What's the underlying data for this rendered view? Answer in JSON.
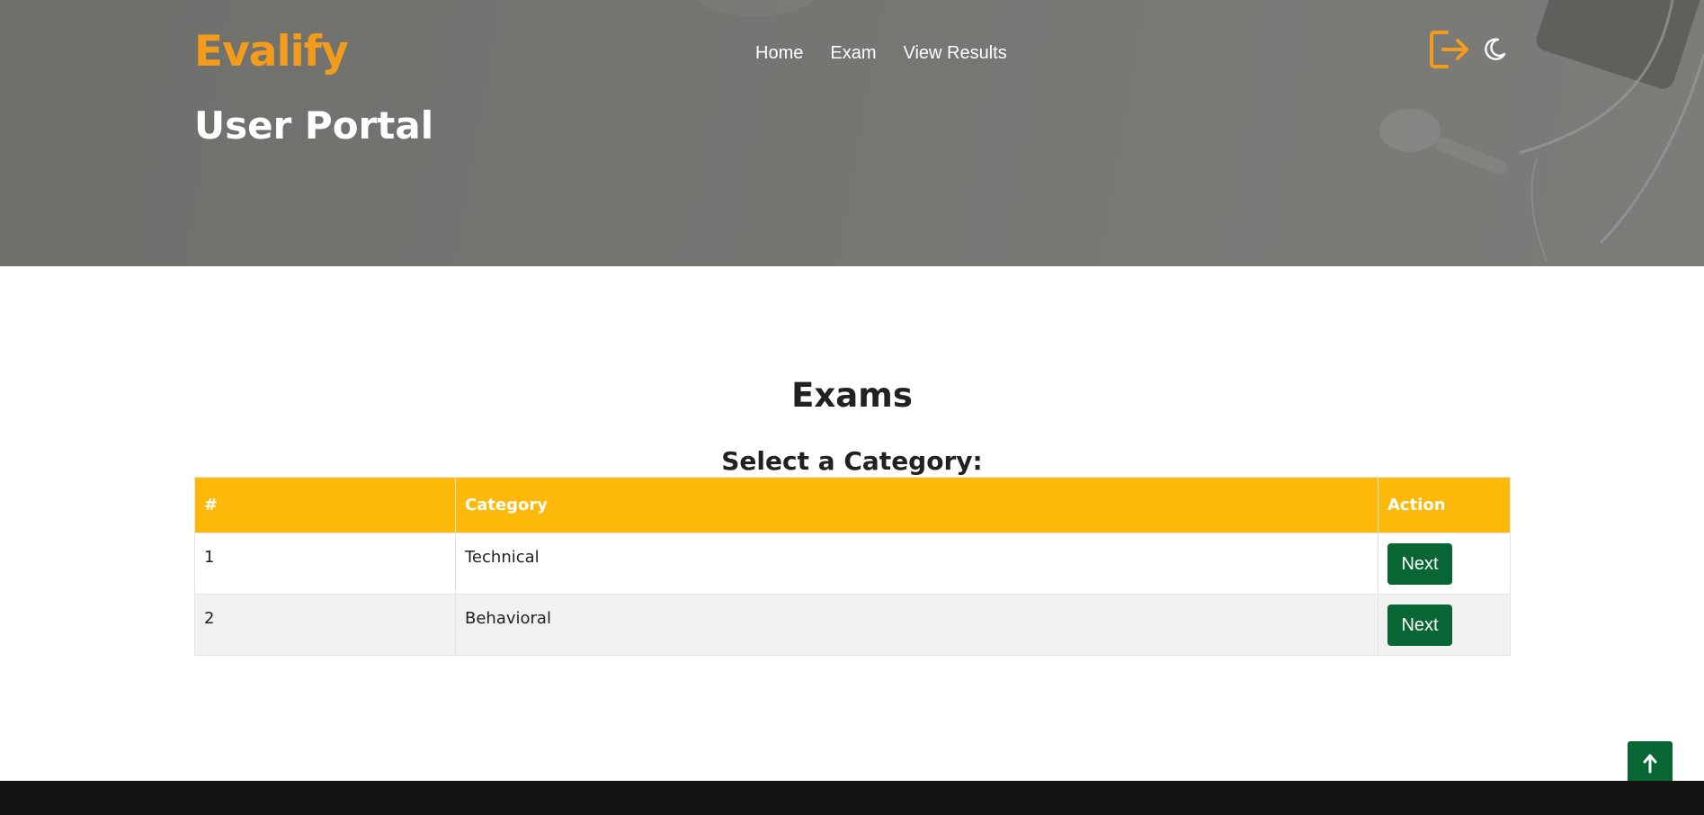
{
  "header": {
    "brand": "Evalify",
    "portal_title": "User Portal",
    "nav": [
      {
        "label": "Home"
      },
      {
        "label": "Exam"
      },
      {
        "label": "View Results"
      }
    ],
    "logout_icon": "logout-icon",
    "theme_icon": "moon-icon",
    "accent_color": "#f39c1b"
  },
  "main": {
    "title": "Exams",
    "subtitle": "Select a Category:",
    "table": {
      "columns": [
        "#",
        "Category",
        "Action"
      ],
      "rows": [
        {
          "num": "1",
          "category": "Technical",
          "action": "Next"
        },
        {
          "num": "2",
          "category": "Behavioral",
          "action": "Next"
        }
      ],
      "header_color": "#fdb90a",
      "button_color": "#076633"
    }
  },
  "back_to_top_icon": "arrow-up-icon"
}
